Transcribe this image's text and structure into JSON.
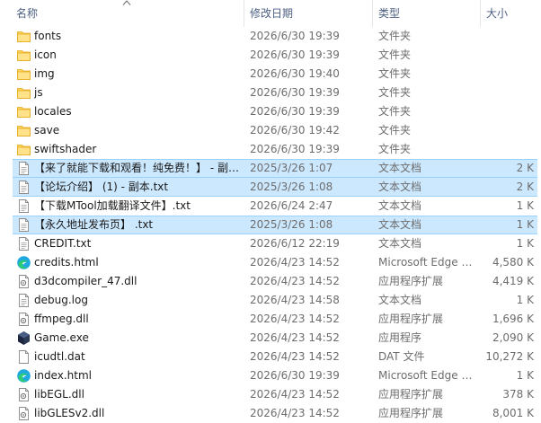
{
  "columns": {
    "name": "名称",
    "date": "修改日期",
    "type": "类型",
    "size": "大小"
  },
  "files": [
    {
      "name": "fonts",
      "date": "2026/6/30 19:39",
      "type": "文件夹",
      "size": "",
      "icon": "folder-icon",
      "selected": false
    },
    {
      "name": "icon",
      "date": "2026/6/30 19:39",
      "type": "文件夹",
      "size": "",
      "icon": "folder-icon",
      "selected": false
    },
    {
      "name": "img",
      "date": "2026/6/30 19:40",
      "type": "文件夹",
      "size": "",
      "icon": "folder-icon",
      "selected": false
    },
    {
      "name": "js",
      "date": "2026/6/30 19:39",
      "type": "文件夹",
      "size": "",
      "icon": "folder-icon",
      "selected": false
    },
    {
      "name": "locales",
      "date": "2026/6/30 19:39",
      "type": "文件夹",
      "size": "",
      "icon": "folder-icon",
      "selected": false
    },
    {
      "name": "save",
      "date": "2026/6/30 19:42",
      "type": "文件夹",
      "size": "",
      "icon": "folder-icon",
      "selected": false
    },
    {
      "name": "swiftshader",
      "date": "2026/6/30 19:39",
      "type": "文件夹",
      "size": "",
      "icon": "folder-icon",
      "selected": false
    },
    {
      "name": "【来了就能下载和观看！纯免费！】 - 副…",
      "date": "2025/3/26 1:07",
      "type": "文本文档",
      "size": "2 K",
      "icon": "text-file-icon",
      "selected": true
    },
    {
      "name": "【论坛介绍】 (1) - 副本.txt",
      "date": "2025/3/26 1:08",
      "type": "文本文档",
      "size": "2 K",
      "icon": "text-file-icon",
      "selected": true
    },
    {
      "name": "【下载MTool加载翻译文件】.txt",
      "date": "2026/6/24 2:47",
      "type": "文本文档",
      "size": "1 K",
      "icon": "text-file-icon",
      "selected": false
    },
    {
      "name": "【永久地址发布页】 .txt",
      "date": "2025/3/26 1:08",
      "type": "文本文档",
      "size": "1 K",
      "icon": "text-file-icon",
      "selected": true
    },
    {
      "name": "CREDIT.txt",
      "date": "2026/6/12 22:19",
      "type": "文本文档",
      "size": "1 K",
      "icon": "text-file-icon",
      "selected": false
    },
    {
      "name": "credits.html",
      "date": "2026/4/23 14:52",
      "type": "Microsoft Edge …",
      "size": "4,580 K",
      "icon": "edge-icon",
      "selected": false
    },
    {
      "name": "d3dcompiler_47.dll",
      "date": "2026/4/23 14:52",
      "type": "应用程序扩展",
      "size": "4,419 K",
      "icon": "dll-file-icon",
      "selected": false
    },
    {
      "name": "debug.log",
      "date": "2026/4/23 14:58",
      "type": "文本文档",
      "size": "1 K",
      "icon": "text-file-icon",
      "selected": false
    },
    {
      "name": "ffmpeg.dll",
      "date": "2026/4/23 14:52",
      "type": "应用程序扩展",
      "size": "1,696 K",
      "icon": "dll-file-icon",
      "selected": false
    },
    {
      "name": "Game.exe",
      "date": "2026/4/23 14:52",
      "type": "应用程序",
      "size": "2,090 K",
      "icon": "game-exe-icon",
      "selected": false
    },
    {
      "name": "icudtl.dat",
      "date": "2026/4/23 14:52",
      "type": "DAT 文件",
      "size": "10,272 K",
      "icon": "blank-file-icon",
      "selected": false
    },
    {
      "name": "index.html",
      "date": "2026/6/30 19:39",
      "type": "Microsoft Edge …",
      "size": "1 K",
      "icon": "edge-icon",
      "selected": false
    },
    {
      "name": "libEGL.dll",
      "date": "2026/4/23 14:52",
      "type": "应用程序扩展",
      "size": "378 K",
      "icon": "dll-file-icon",
      "selected": false
    },
    {
      "name": "libGLESv2.dll",
      "date": "2026/4/23 14:52",
      "type": "应用程序扩展",
      "size": "8,001 K",
      "icon": "dll-file-icon",
      "selected": false
    }
  ]
}
